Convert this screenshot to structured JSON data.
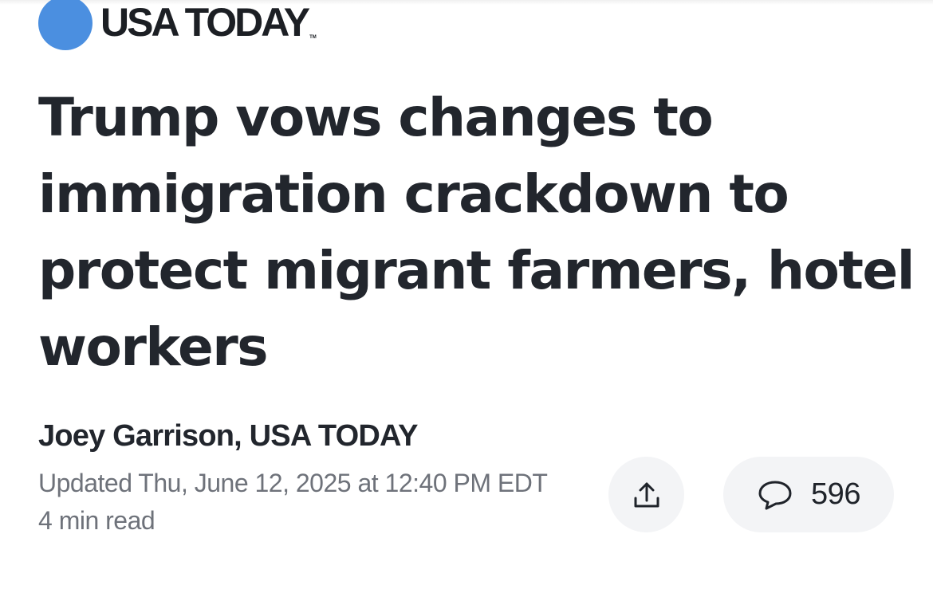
{
  "brand": {
    "name": "USA TODAY",
    "trademark": "TM",
    "dot_color": "#4b8fe0"
  },
  "article": {
    "headline": "Trump vows changes to immigration crackdown to protect migrant farmers, hotel workers",
    "byline": "Joey Garrison, USA TODAY",
    "updated": "Updated Thu, June 12, 2025 at 12:40 PM EDT",
    "read_time": "4 min read"
  },
  "actions": {
    "share_icon": "share-icon",
    "comment_icon": "comment-bubble-icon",
    "comment_count": "596"
  }
}
